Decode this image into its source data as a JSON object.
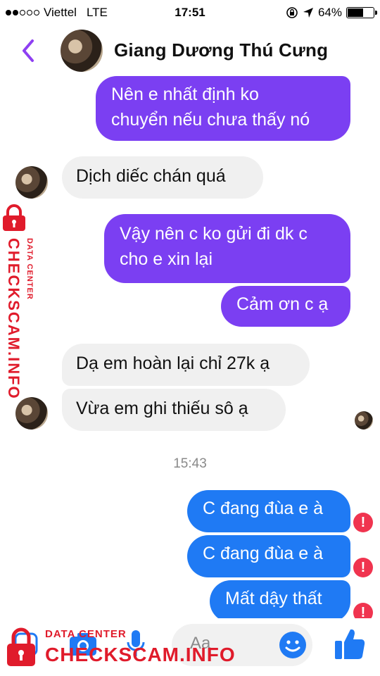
{
  "status_bar": {
    "carrier": "Viettel",
    "network": "LTE",
    "time": "17:51",
    "battery": "64%",
    "battery_level": 0.64
  },
  "header": {
    "contact_name": "Giang Dương Thú Cưng"
  },
  "messages": [
    {
      "id": "m1",
      "side": "out",
      "color": "purple",
      "text_lines": [
        "Nên e nhất định ko",
        "chuyển nếu chưa thấy nó"
      ]
    },
    {
      "id": "m2",
      "side": "in",
      "text": "Dịch diếc chán quá"
    },
    {
      "id": "m3",
      "side": "out",
      "color": "purple",
      "text_lines": [
        "Vậy nên c ko gửi đi dk c",
        "cho e xin lại"
      ]
    },
    {
      "id": "m4",
      "side": "out",
      "color": "purple",
      "text": "Cảm ơn c ạ"
    },
    {
      "id": "m5",
      "side": "in",
      "text": "Dạ em hoàn lại chỉ 27k ạ"
    },
    {
      "id": "m6",
      "side": "in",
      "text": "Vừa em ghi thiếu sô ạ"
    },
    {
      "id": "ts1",
      "type": "timestamp",
      "text": "15:43"
    },
    {
      "id": "m7",
      "side": "out",
      "color": "blue",
      "text": "C đang đùa e à",
      "error": true
    },
    {
      "id": "m8",
      "side": "out",
      "color": "blue",
      "text": "C đang đùa e à",
      "error": true
    },
    {
      "id": "m9",
      "side": "out",
      "color": "blue",
      "text": "Mất dậy thất",
      "error": true
    }
  ],
  "composer": {
    "placeholder": "Aa"
  },
  "watermark": {
    "side_brand": "CHECKSCAM.INFO",
    "side_label": "DATA CENTER",
    "bottom_label": "DATA CENTER",
    "bottom_brand": "CHECKSCAM.INFO"
  },
  "colors": {
    "purple": "#7b3ff2",
    "blue": "#1f7af4",
    "incoming": "#f0f0f0",
    "error": "#f0344f",
    "header_accent": "#8e3ff2",
    "watermark": "#e01b2b"
  }
}
